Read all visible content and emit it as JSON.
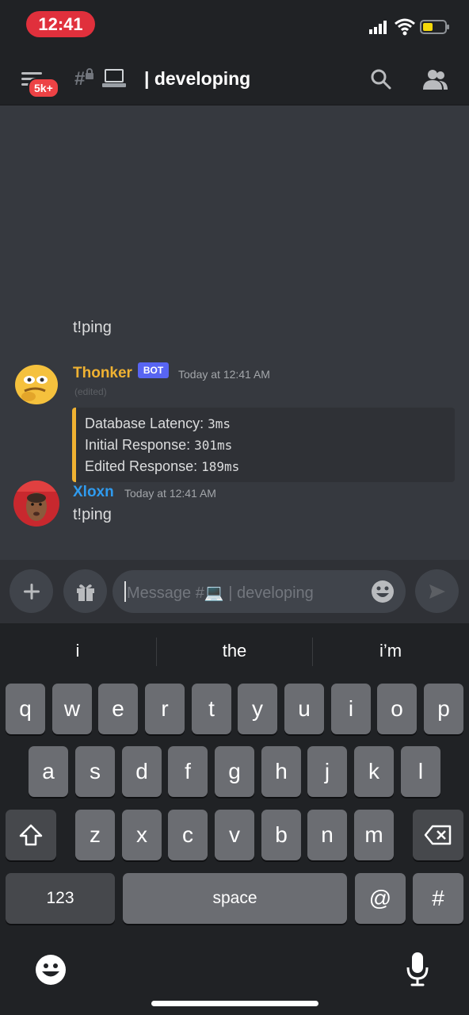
{
  "status_bar": {
    "time": "12:41"
  },
  "header": {
    "channel_title": "| developing",
    "unread_badge": "5k+",
    "hash": "#"
  },
  "messages": [
    {
      "text": "t!ping"
    },
    {
      "author": "Thonker",
      "tag": "BOT",
      "timestamp": "Today at 12:41 AM",
      "edited": "(edited)",
      "embed": [
        {
          "label": "Database Latency: ",
          "value": "3ms"
        },
        {
          "label": "Initial Response: ",
          "value": "301ms"
        },
        {
          "label": "Edited Response: ",
          "value": "189ms"
        }
      ]
    },
    {
      "author": "Xloxn",
      "timestamp": "Today at 12:41 AM",
      "text": "t!ping"
    }
  ],
  "composer": {
    "placeholder": "Message #💻 | developing"
  },
  "keyboard": {
    "suggestions": [
      "i",
      "the",
      "i’m"
    ],
    "row1": [
      "q",
      "w",
      "e",
      "r",
      "t",
      "y",
      "u",
      "i",
      "o",
      "p"
    ],
    "row2": [
      "a",
      "s",
      "d",
      "f",
      "g",
      "h",
      "j",
      "k",
      "l"
    ],
    "row3": [
      "z",
      "x",
      "c",
      "v",
      "b",
      "n",
      "m"
    ],
    "numbers_key": "123",
    "space_key": "space",
    "at_key": "@",
    "hash_key": "#"
  },
  "colors": {
    "bot_name": "#f0b232",
    "user_name": "#2f9bef",
    "accent": "#5865f2",
    "badge": "#ed4245"
  }
}
